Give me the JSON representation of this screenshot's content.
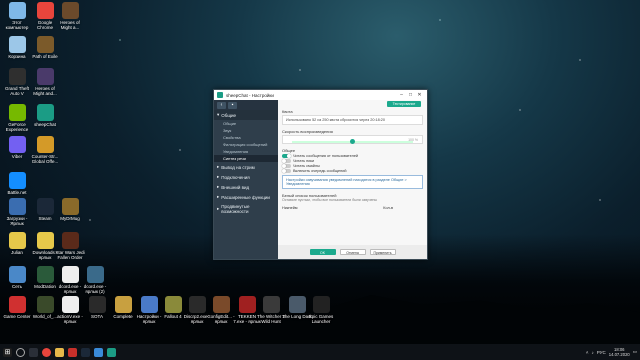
{
  "desktop_icons": [
    {
      "label": "Этот компьютер",
      "color": "#7fb8e8"
    },
    {
      "label": "Google Chrome",
      "color": "#e8453c"
    },
    {
      "label": "Heroes of Might a...",
      "color": "#6b4a2b"
    },
    {
      "label": "Корзина",
      "color": "#9cc7e8"
    },
    {
      "label": "Path of Exile",
      "color": "#7b5a2a"
    },
    {
      "label": "Grand Theft Auto V",
      "color": "#2f2f2f"
    },
    {
      "label": "Heroes of Might and...",
      "color": "#4a3a6a"
    },
    {
      "label": "GeForce Experience",
      "color": "#76b900"
    },
    {
      "label": "sheepChat",
      "color": "#1b9c85"
    },
    {
      "label": "Viber",
      "color": "#7360f2"
    },
    {
      "label": "Counter-Str... Global Offe...",
      "color": "#d49a28"
    },
    {
      "label": "Battle.net",
      "color": "#148eff"
    },
    {
      "label": "Загрузки - Ярлык",
      "color": "#3a6db0"
    },
    {
      "label": "Steam",
      "color": "#1b2838"
    },
    {
      "label": "MyDrMug",
      "color": "#8a6a2a"
    },
    {
      "label": "Julian",
      "color": "#e6c84a"
    },
    {
      "label": "Downloads - ярлык",
      "color": "#e6c84a"
    },
    {
      "label": "Star Wars Jedi Fallen Order",
      "color": "#5a2a1a"
    },
    {
      "label": "Сеть",
      "color": "#4a88c8"
    },
    {
      "label": "ModDation",
      "color": "#2a5a3a"
    },
    {
      "label": "dcord.exe - ярлык",
      "color": "#eeeeee"
    },
    {
      "label": "dcord.exe - ярлык (2)",
      "color": "#3a6a8a"
    },
    {
      "label": "Game Center",
      "color": "#d03030"
    },
    {
      "label": "World_of_...",
      "color": "#3a4a2a"
    },
    {
      "label": "actionV.exe - ярлык",
      "color": "#eeeeee"
    },
    {
      "label": "SOTA",
      "color": "#2a2a2a"
    },
    {
      "label": "Complete",
      "color": "#c8a040"
    },
    {
      "label": "Настройки - ярлык",
      "color": "#4a7ac8"
    },
    {
      "label": "Fallout 4",
      "color": "#8a8a3a"
    },
    {
      "label": "Discrp2.exe - ярлык",
      "color": "#2a2a2a"
    },
    {
      "label": "ConfigEdit... - ярлык",
      "color": "#7a4a2a"
    },
    {
      "label": "TEKKEN 7.exe - ярлык",
      "color": "#a02020"
    },
    {
      "label": "The Witcher 3 Wild Hunt",
      "color": "#3a3a3a"
    },
    {
      "label": "The Long Dark",
      "color": "#4a5a6a"
    },
    {
      "label": "Epic Games Launcher",
      "color": "#222222"
    }
  ],
  "window": {
    "title": "sheepChat - Настройки",
    "sidebar": {
      "sections": [
        {
          "label": "Общие",
          "expanded": true,
          "items": [
            "Общие",
            "Звук",
            "Свойства",
            "Фильтрация сообщений",
            "Уведомления",
            "Синтез речи"
          ],
          "selected": "Синтез речи"
        },
        {
          "label": "Вывод на стрим"
        },
        {
          "label": "Подключения"
        },
        {
          "label": "Внешний вид"
        },
        {
          "label": "Расширенные функции"
        },
        {
          "label": "Продвинутые возможности"
        }
      ]
    },
    "content": {
      "test_button": "Тестирование",
      "quota_heading": "Квота",
      "quota_text": "Использовано 52 из 250 квота сбросится через 20:18:20",
      "speed_heading": "Скорость воспроизведения",
      "speed_value": "100 %",
      "speed_level": 0.5,
      "general_heading": "Общее",
      "toggles": [
        {
          "label": "Читать сообщения от пользователей",
          "on": true
        },
        {
          "label": "Читать ники",
          "on": false
        },
        {
          "label": "Читать смайлы",
          "on": false
        },
        {
          "label": "Включить очередь сообщений",
          "on": false
        }
      ],
      "info_text": "Настройки озвучивания уведомлений находятся в разделе Общие > Уведомления",
      "whitelist_heading": "Белый список пользователей",
      "whitelist_note": "Оставьте пустым, чтобы все пользователи были озвучены",
      "col_nick": "Никнейм",
      "col_count": "Кол-в"
    },
    "footer": {
      "ok": "OK",
      "cancel": "Отмена",
      "apply": "Применить"
    }
  },
  "taskbar": {
    "language": "РУС",
    "time": "18:06",
    "date": "14.07.2020"
  }
}
